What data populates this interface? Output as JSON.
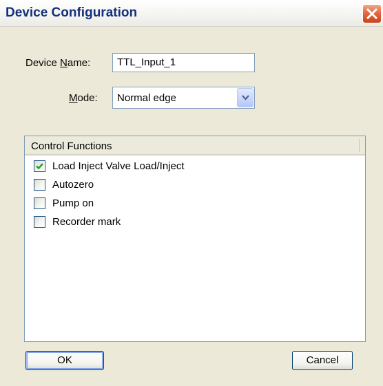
{
  "window": {
    "title": "Device Configuration",
    "close_icon": "close-icon"
  },
  "form": {
    "device_name_label_pre": "Device ",
    "device_name_label_accel": "N",
    "device_name_label_post": "ame:",
    "device_name_value": "TTL_Input_1",
    "mode_label_accel": "M",
    "mode_label_post": "ode:",
    "mode_value": "Normal edge"
  },
  "control_functions": {
    "header": "Control Functions",
    "items": [
      {
        "label": "Load Inject Valve Load/Inject",
        "checked": true
      },
      {
        "label": "Autozero",
        "checked": false
      },
      {
        "label": "Pump on",
        "checked": false
      },
      {
        "label": "Recorder mark",
        "checked": false
      }
    ]
  },
  "buttons": {
    "ok": "OK",
    "cancel": "Cancel"
  },
  "colors": {
    "title_text": "#14307a",
    "dialog_bg": "#ece9d8",
    "check_mark": "#21a121",
    "close_button": "#e26a43"
  }
}
